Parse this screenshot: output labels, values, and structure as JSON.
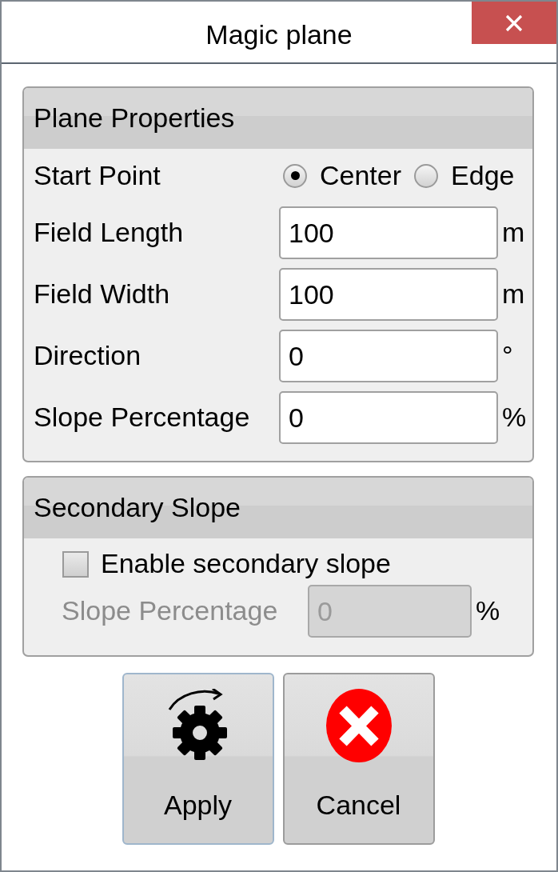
{
  "window": {
    "title": "Magic plane"
  },
  "plane_properties": {
    "title": "Plane Properties",
    "start_point": {
      "label": "Start Point",
      "options": [
        {
          "label": "Center",
          "selected": true
        },
        {
          "label": "Edge",
          "selected": false
        }
      ]
    },
    "fields": [
      {
        "label": "Field Length",
        "value": "100",
        "unit": "m"
      },
      {
        "label": "Field Width",
        "value": "100",
        "unit": "m"
      },
      {
        "label": "Direction",
        "value": "0",
        "unit": "°"
      },
      {
        "label": "Slope Percentage",
        "value": "0",
        "unit": "%"
      }
    ]
  },
  "secondary_slope": {
    "title": "Secondary Slope",
    "enable": {
      "label": "Enable secondary slope",
      "checked": false
    },
    "slope": {
      "label": "Slope Percentage",
      "value": "0",
      "unit": "%",
      "disabled": true
    }
  },
  "buttons": [
    {
      "label": "Apply",
      "kind": "apply",
      "focused": true
    },
    {
      "label": "Cancel",
      "kind": "cancel",
      "focused": false
    }
  ]
}
